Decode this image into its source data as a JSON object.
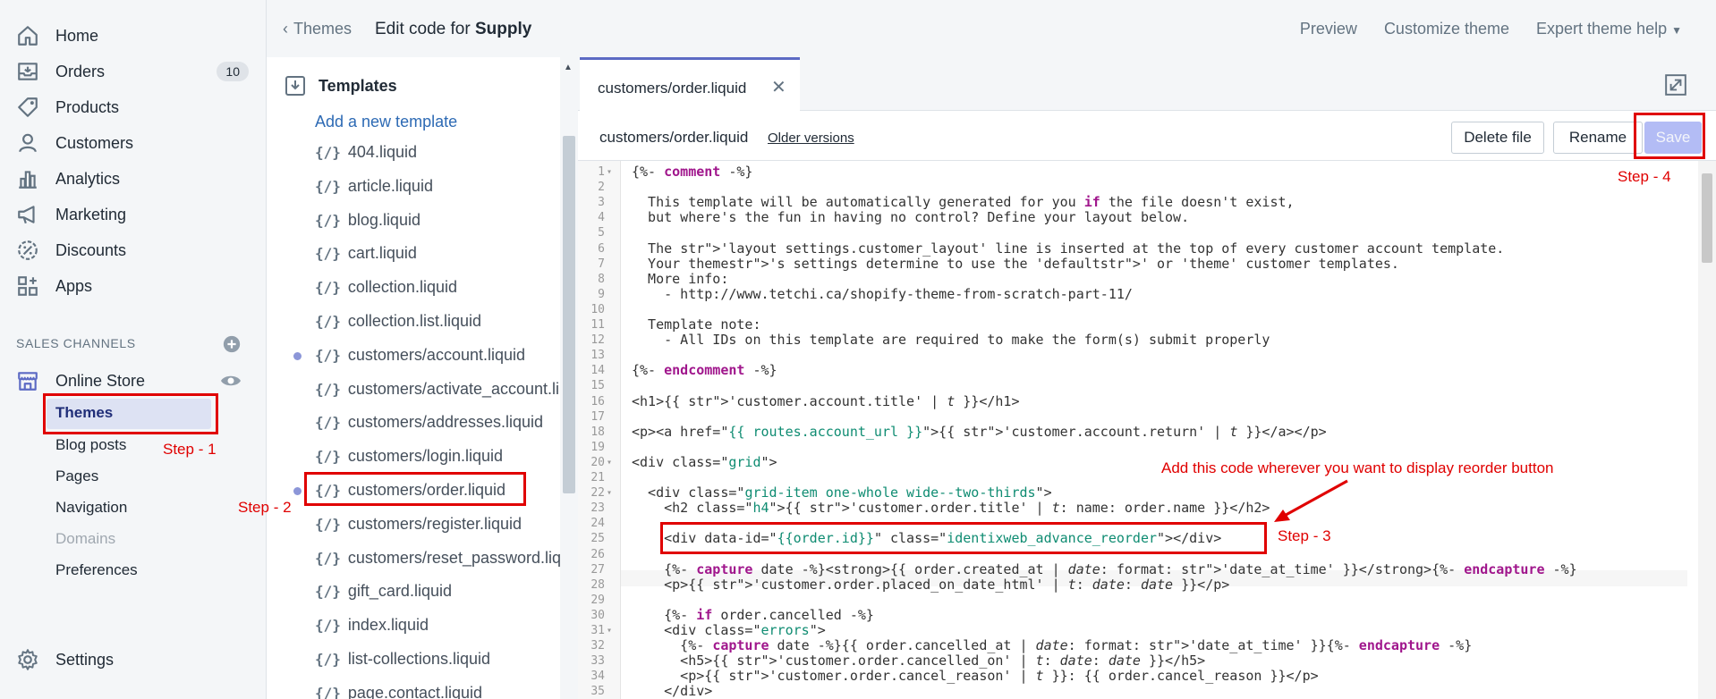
{
  "sidebar": {
    "items": [
      {
        "label": "Home",
        "icon": "home-icon"
      },
      {
        "label": "Orders",
        "icon": "orders-icon",
        "badge": "10"
      },
      {
        "label": "Products",
        "icon": "tag-icon"
      },
      {
        "label": "Customers",
        "icon": "person-icon"
      },
      {
        "label": "Analytics",
        "icon": "chart-icon"
      },
      {
        "label": "Marketing",
        "icon": "megaphone-icon"
      },
      {
        "label": "Discounts",
        "icon": "discount-icon"
      },
      {
        "label": "Apps",
        "icon": "apps-icon"
      }
    ],
    "sales_channels": "SALES CHANNELS",
    "online_store": "Online Store",
    "sub_items": [
      "Themes",
      "Blog posts",
      "Pages",
      "Navigation",
      "Domains",
      "Preferences"
    ],
    "settings": "Settings"
  },
  "topbar": {
    "back": "Themes",
    "edit_prefix": "Edit code for",
    "theme_name": "Supply",
    "preview": "Preview",
    "customize": "Customize theme",
    "help": "Expert theme help"
  },
  "filetree": {
    "folder": "Templates",
    "add": "Add a new template",
    "files": [
      "404.liquid",
      "article.liquid",
      "blog.liquid",
      "cart.liquid",
      "collection.liquid",
      "collection.list.liquid",
      "customers/account.liquid",
      "customers/activate_account.li",
      "customers/addresses.liquid",
      "customers/login.liquid",
      "customers/order.liquid",
      "customers/register.liquid",
      "customers/reset_password.liq",
      "gift_card.liquid",
      "index.liquid",
      "list-collections.liquid",
      "page.contact.liquid"
    ],
    "file_icon": "{/}"
  },
  "editor": {
    "tab_label": "customers/order.liquid",
    "tab_close": "✕",
    "file_name": "customers/order.liquid",
    "older_versions": "Older versions",
    "delete": "Delete file",
    "rename": "Rename",
    "save": "Save"
  },
  "code_lines": [
    "{%- comment -%}",
    "",
    "  This template will be automatically generated for you if the file doesn't exist,",
    "  but where's the fun in having no control? Define your layout below.",
    "",
    "  The 'layout settings.customer_layout' line is inserted at the top of every customer account template.",
    "  Your theme's settings determine to use the 'default' or 'theme' customer templates.",
    "  More info:",
    "    - http://www.tetchi.ca/shopify-theme-from-scratch-part-11/",
    "",
    "  Template note:",
    "    - All IDs on this template are required to make the form(s) submit properly",
    "",
    "{%- endcomment -%}",
    "",
    "<h1>{{ 'customer.account.title' | t }}</h1>",
    "",
    "<p><a href=\"{{ routes.account_url }}\">{{ 'customer.account.return' | t }}</a></p>",
    "",
    "<div class=\"grid\">",
    "",
    "  <div class=\"grid-item one-whole wide--two-thirds\">",
    "    <h2 class=\"h4\">{{ 'customer.order.title' | t: name: order.name }}</h2>",
    "",
    "    <div data-id=\"{{order.id}}\" class=\"identixweb_advance_reorder\"></div>",
    "",
    "    {%- capture date -%}<strong>{{ order.created_at | date: format: 'date_at_time' }}</strong>{%- endcapture -%}",
    "    <p>{{ 'customer.order.placed_on_date_html' | t: date: date }}</p>",
    "",
    "    {%- if order.cancelled -%}",
    "    <div class=\"errors\">",
    "      {%- capture date -%}{{ order.cancelled_at | date: format: 'date_at_time' }}{%- endcapture -%}",
    "      <h5>{{ 'customer.order.cancelled_on' | t: date: date }}</h5>",
    "      <p>{{ 'customer.order.cancel_reason' | t }}: {{ order.cancel_reason }}</p>",
    "    </div>"
  ],
  "fold_lines": [
    1,
    20,
    22,
    31
  ],
  "annotations": {
    "step1": "Step - 1",
    "step2": "Step - 2",
    "step3": "Step - 3",
    "step4": "Step - 4",
    "note": "Add this code wherever you want to display reorder button"
  },
  "colors": {
    "accent": "#5c6ac4",
    "annotation": "#e00000",
    "save_disabled": "#b3bcf5"
  }
}
